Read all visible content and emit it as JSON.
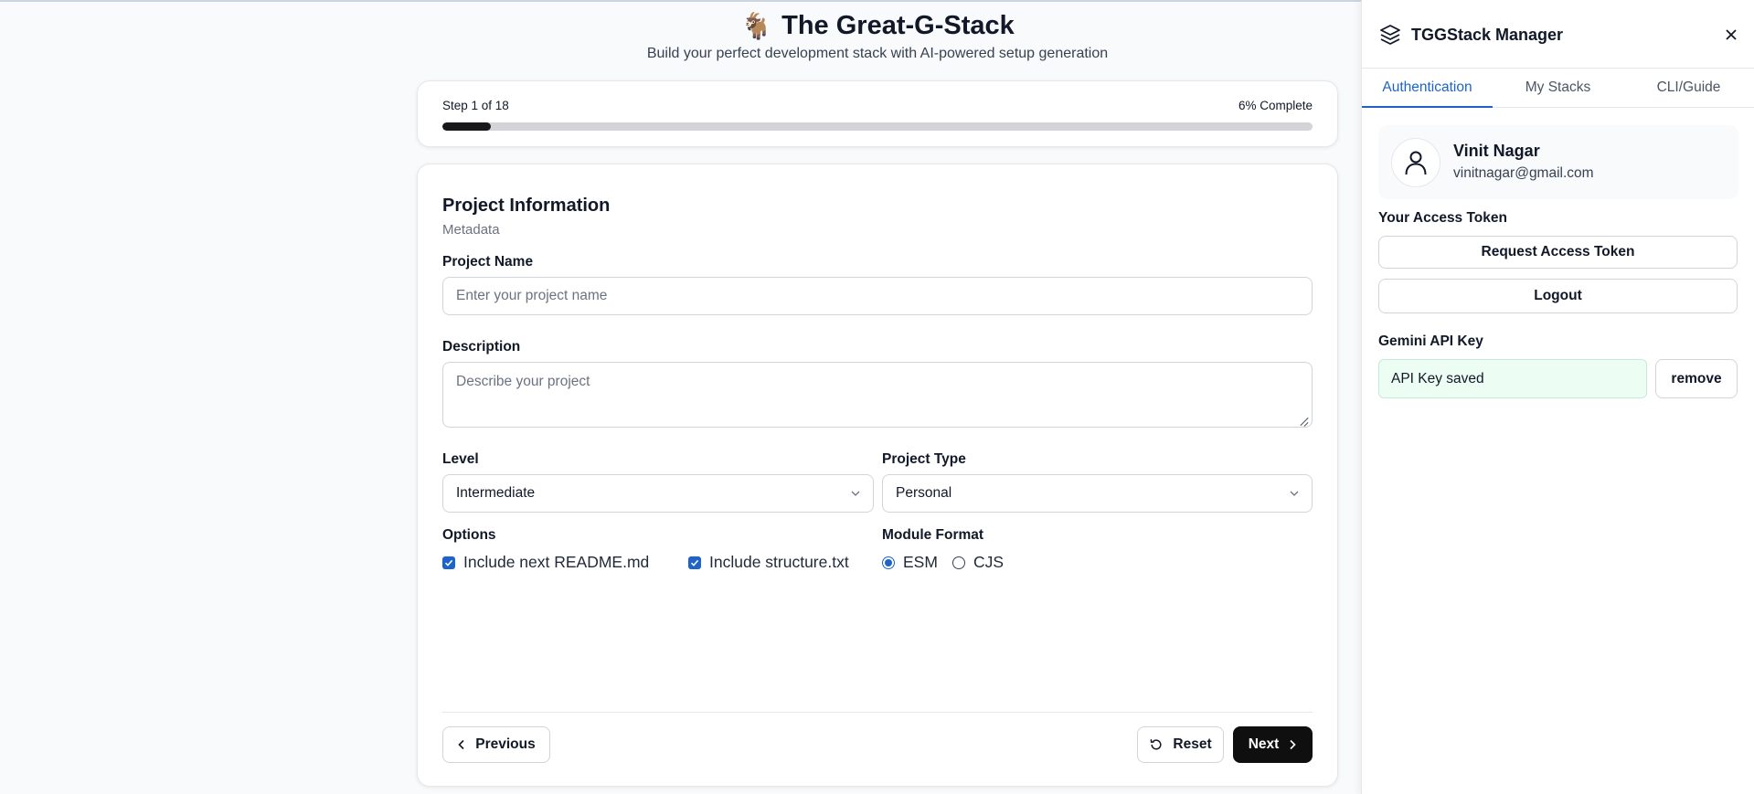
{
  "header": {
    "emoji": "🐐",
    "title": "The Great-G-Stack",
    "subtitle": "Build your perfect development stack with AI-powered setup generation"
  },
  "progress": {
    "step_label": "Step 1 of 18",
    "complete_label": "6% Complete",
    "fraction": 0.056
  },
  "form": {
    "section_title": "Project Information",
    "section_subtitle": "Metadata",
    "project_name": {
      "label": "Project Name",
      "placeholder": "Enter your project name",
      "value": ""
    },
    "description": {
      "label": "Description",
      "placeholder": "Describe your project",
      "value": ""
    },
    "level": {
      "label": "Level",
      "value": "Intermediate"
    },
    "project_type": {
      "label": "Project Type",
      "value": "Personal"
    },
    "options": {
      "label": "Options",
      "items": [
        {
          "label": "Include next README.md",
          "checked": true
        },
        {
          "label": "Include structure.txt",
          "checked": true
        }
      ]
    },
    "module_format": {
      "label": "Module Format",
      "items": [
        {
          "label": "ESM",
          "selected": true
        },
        {
          "label": "CJS",
          "selected": false
        }
      ]
    },
    "buttons": {
      "previous": "Previous",
      "reset": "Reset",
      "next": "Next"
    }
  },
  "panel": {
    "title": "TGGStack Manager",
    "tabs": [
      {
        "label": "Authentication",
        "active": true
      },
      {
        "label": "My Stacks",
        "active": false
      },
      {
        "label": "CLI/Guide",
        "active": false
      }
    ],
    "user": {
      "name": "Vinit Nagar",
      "email": "vinitnagar@gmail.com"
    },
    "access_token": {
      "label": "Your Access Token",
      "request_button": "Request Access Token",
      "logout_button": "Logout"
    },
    "gemini": {
      "label": "Gemini API Key",
      "status": "API Key saved",
      "remove_button": "remove"
    }
  },
  "colors": {
    "accent": "#1d63c9",
    "primary_dark": "#0f0f10",
    "saved_bg": "#ecfdf3"
  },
  "icons": [
    "goat-emoji",
    "chevron-left-icon",
    "chevron-right-icon",
    "chevron-down-icon",
    "reset-icon",
    "layers-icon",
    "close-icon",
    "user-icon",
    "check-icon"
  ]
}
